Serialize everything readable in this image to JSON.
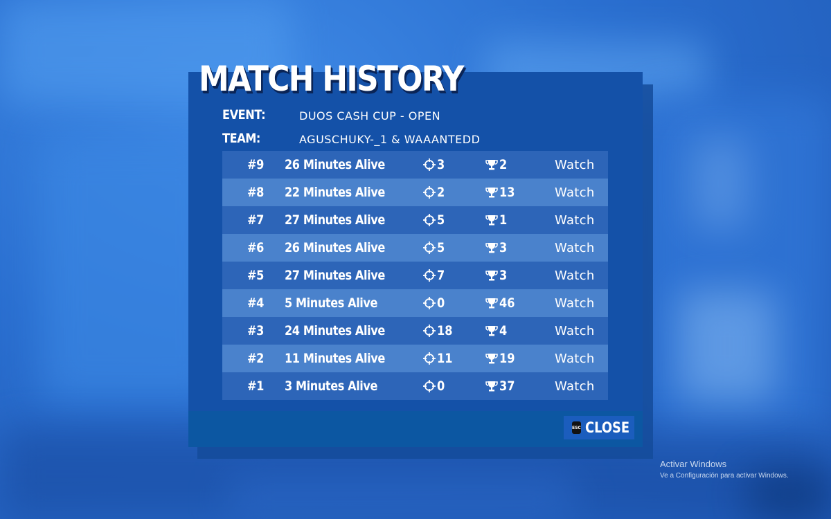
{
  "dialog": {
    "title": "MATCH HISTORY",
    "event_label": "EVENT:",
    "event_value": "DUOS CASH CUP - OPEN",
    "team_label": "TEAM:",
    "team_value": "AGUSCHUKY-_1 & WAAANTEDD"
  },
  "matches": [
    {
      "rank": "#9",
      "time": "26 Minutes Alive",
      "elims": "3",
      "placement": "2",
      "action": "Watch"
    },
    {
      "rank": "#8",
      "time": "22 Minutes Alive",
      "elims": "2",
      "placement": "13",
      "action": "Watch"
    },
    {
      "rank": "#7",
      "time": "27 Minutes Alive",
      "elims": "5",
      "placement": "1",
      "action": "Watch"
    },
    {
      "rank": "#6",
      "time": "26 Minutes Alive",
      "elims": "5",
      "placement": "3",
      "action": "Watch"
    },
    {
      "rank": "#5",
      "time": "27 Minutes Alive",
      "elims": "7",
      "placement": "3",
      "action": "Watch"
    },
    {
      "rank": "#4",
      "time": "5 Minutes Alive",
      "elims": "0",
      "placement": "46",
      "action": "Watch"
    },
    {
      "rank": "#3",
      "time": "24 Minutes Alive",
      "elims": "18",
      "placement": "4",
      "action": "Watch"
    },
    {
      "rank": "#2",
      "time": "11 Minutes Alive",
      "elims": "11",
      "placement": "19",
      "action": "Watch"
    },
    {
      "rank": "#1",
      "time": "3 Minutes Alive",
      "elims": "0",
      "placement": "37",
      "action": "Watch"
    }
  ],
  "icons": {
    "elims": "crosshair-icon",
    "placement": "trophy-icon"
  },
  "footer": {
    "esc_key": "ESC",
    "close_label": "CLOSE"
  },
  "watermark": {
    "line1": "Activar Windows",
    "line2": "Ve a Configuración para activar Windows."
  },
  "colors": {
    "panel": "#1451a8",
    "row_odd": "#2d65b8",
    "row_even": "#4a82cc",
    "footer": "#0c57a2",
    "text": "#ffffff"
  }
}
